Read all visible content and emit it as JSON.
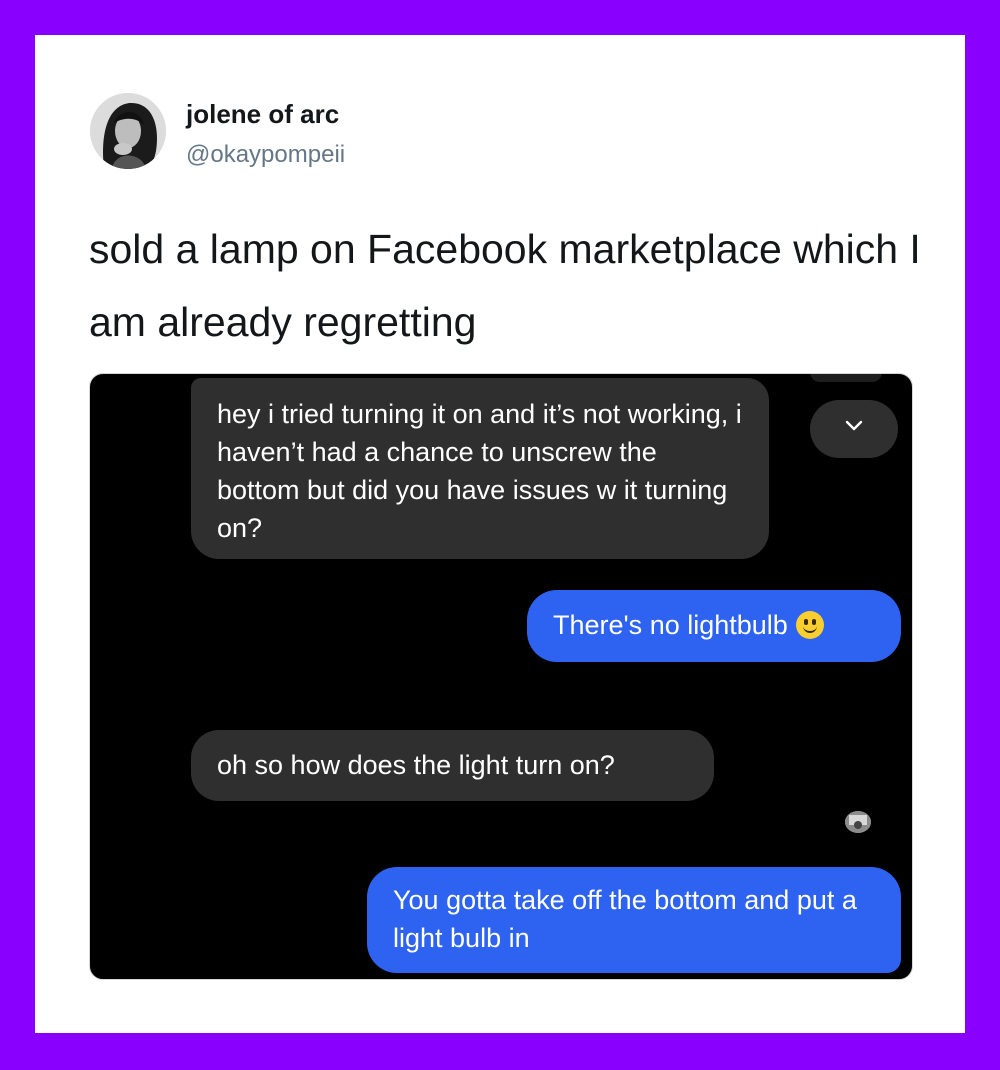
{
  "tweet": {
    "display_name": "jolene of arc",
    "handle": "@okaypompeii",
    "text": "sold a lamp on Facebook marketplace which I am already regretting"
  },
  "chat": {
    "messages": [
      {
        "direction": "incoming",
        "text": "hey i tried turning it on and it’s not working, i haven’t had a chance to unscrew the bottom but did you have issues w it turning on?"
      },
      {
        "direction": "outgoing",
        "text": "There's no lightbulb",
        "emoji": "slightly-smiling-face-icon"
      },
      {
        "direction": "incoming",
        "text": "oh so how does the light turn on?"
      },
      {
        "direction": "outgoing",
        "text": "You gotta take off the bottom and put a light bulb in"
      }
    ]
  },
  "colors": {
    "page_border": "#8a00ff",
    "outgoing_bubble": "#2d63f0",
    "incoming_bubble": "#2f2f2f",
    "chat_background": "#000000"
  }
}
